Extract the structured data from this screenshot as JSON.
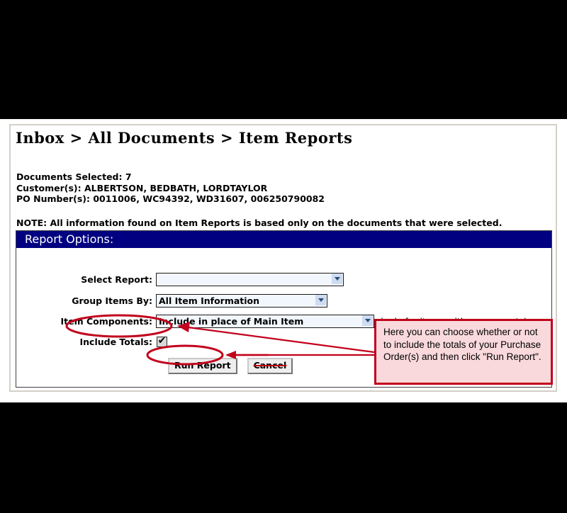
{
  "window": {
    "frame_background": "#000000",
    "page_background": "#ffffff",
    "frame_border_color": "#d4d0c8"
  },
  "header": {
    "breadcrumb_title": "Inbox > All Documents > Item Reports"
  },
  "summary": {
    "documents_selected": "Documents Selected: 7",
    "customers": "Customer(s): ALBERTSON, BEDBATH, LORDTAYLOR",
    "po_numbers": "PO Number(s): 0011006, WC94392, WD31607, 006250790082",
    "note": "NOTE: All information found on Item Reports is based only on the documents that were selected."
  },
  "report_options": {
    "panel_title": "Report Options:",
    "panel_title_bg": "#000080",
    "fields": {
      "select_report": {
        "label": "Select Report:",
        "value": "",
        "options": [
          ""
        ]
      },
      "group_items_by": {
        "label": "Group Items By:",
        "value": "All Item Information",
        "options": [
          "All Item Information"
        ]
      },
      "item_components": {
        "label": "Item Components:",
        "value": "Include in place of Main Item",
        "options": [
          "Include in place of Main Item"
        ],
        "hint": "(only for items with components)"
      },
      "include_totals": {
        "label": "Include Totals:",
        "checked": true,
        "check_glyph": "✔"
      }
    },
    "buttons": {
      "run_report": "Run Report",
      "cancel": "Cancel"
    }
  },
  "annotation": {
    "callout_text": "Here you can choose whether or not to include the totals of your Purchase Order(s) and then click \"Run Report\".",
    "callout_bg": "#f9d9dc",
    "callout_border": "#c2001b",
    "highlight_color": "#c2001b",
    "highlighted_elements": [
      "include-totals-field",
      "run-report-button"
    ],
    "struck_elements": [
      "cancel-button"
    ]
  }
}
